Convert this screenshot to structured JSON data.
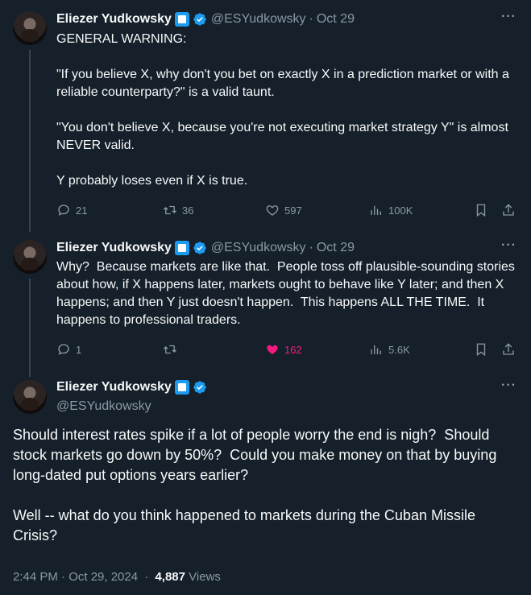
{
  "author": {
    "name": "Eliezer Yudkowsky",
    "handle": "@ESYudkowsky"
  },
  "tweets": [
    {
      "date": "Oct 29",
      "text": "GENERAL WARNING:\n\n\"If you believe X, why don't you bet on exactly X in a prediction market or with a reliable counterparty?\" is a valid taunt.\n\n\"You don't believe X, because you're not executing market strategy Y\" is almost NEVER valid.\n\nY probably loses even if X is true.",
      "replies": "21",
      "reposts": "36",
      "likes": "597",
      "views": "100K"
    },
    {
      "date": "Oct 29",
      "text": "Why?  Because markets are like that.  People toss off plausible-sounding stories about how, if X happens later, markets ought to behave like Y later; and then X happens; and then Y just doesn't happen.  This happens ALL THE TIME.  It happens to professional traders.",
      "replies": "1",
      "reposts": "",
      "likes": "162",
      "views": "5.6K"
    }
  ],
  "main_tweet": {
    "text": "Should interest rates spike if a lot of people worry the end is nigh?  Should stock markets go down by 50%?  Could you make money on that by buying long-dated put options years earlier?\n\nWell -- what do you think happened to markets during the Cuban Missile Crisis?",
    "timestamp": "2:44 PM · Oct 29, 2024",
    "views_count": "4,887",
    "views_label": "Views"
  },
  "symbols": {
    "dot": "·",
    "more": "···"
  },
  "colors": {
    "background": "#15202b",
    "text": "#f7f9f9",
    "muted": "#8b98a5",
    "accent": "#1d9bf0",
    "like": "#f91880"
  }
}
